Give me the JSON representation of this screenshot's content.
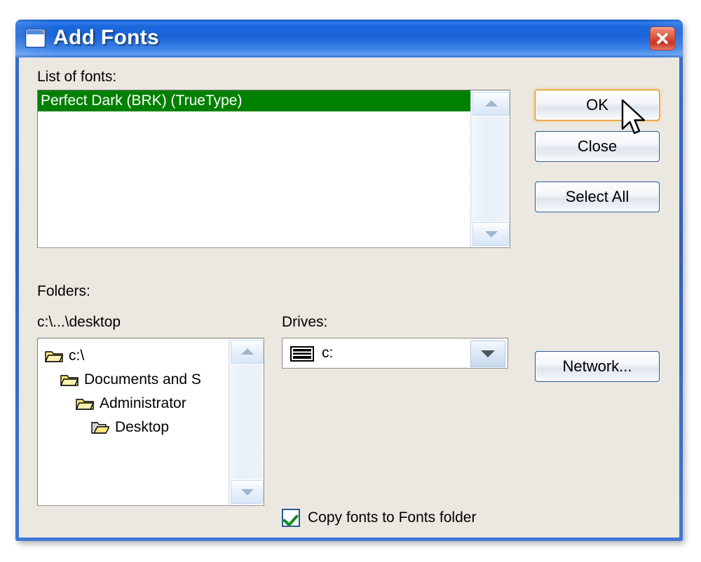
{
  "window": {
    "title": "Add Fonts",
    "icon": "window-icon",
    "close_icon": "close-icon",
    "titlebar_color": "#1a63d8",
    "client_color": "#ebe8e2",
    "frame_color": "#2f62bf"
  },
  "fonts_section": {
    "label": "List of fonts:",
    "items": [
      {
        "name": "Perfect Dark (BRK) (TrueType)",
        "selected": true
      }
    ],
    "selection_color": "#008000",
    "selection_text_color": "#ffffff"
  },
  "folders_section": {
    "label": "Folders:",
    "path": "c:\\...\\desktop",
    "tree": [
      {
        "label": "c:\\",
        "indent": 0,
        "icon": "folder-closed-icon"
      },
      {
        "label": "Documents and S",
        "indent": 1,
        "icon": "folder-closed-icon"
      },
      {
        "label": "Administrator",
        "indent": 2,
        "icon": "folder-closed-icon"
      },
      {
        "label": "Desktop",
        "indent": 3,
        "icon": "folder-open-icon"
      }
    ]
  },
  "drives_section": {
    "label": "Drives:",
    "selected": "c:",
    "icon": "hard-drive-icon",
    "dropdown_icon": "chevron-down-icon"
  },
  "options": {
    "copy_fonts_label": "Copy fonts to Fonts folder",
    "copy_fonts_checked": true,
    "check_color": "#128a1c"
  },
  "buttons": {
    "ok": "OK",
    "close": "Close",
    "select_all": "Select All",
    "network": "Network...",
    "default_focus": "ok",
    "focus_color": "#f5b042"
  },
  "scrollbars": {
    "up_icon": "chevron-up-icon",
    "down_icon": "chevron-down-icon"
  },
  "cursor": {
    "icon": "arrow-pointer-cursor"
  }
}
